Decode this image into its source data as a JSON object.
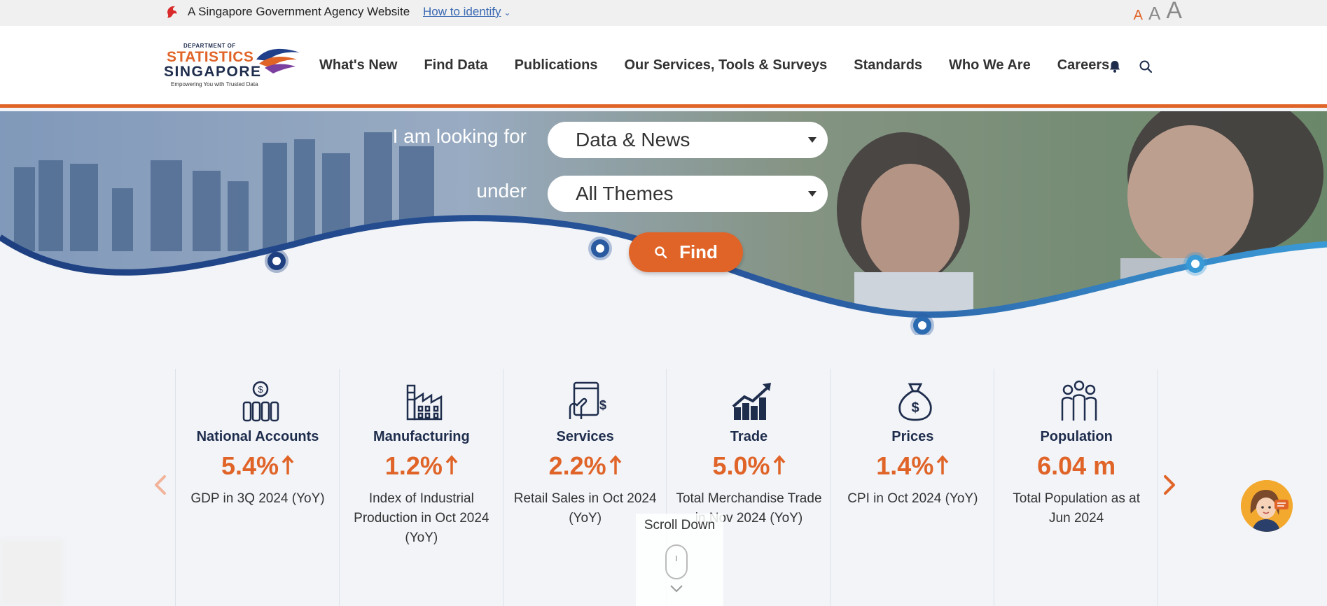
{
  "govbar": {
    "text": "A Singapore Government Agency Website",
    "how_to_identify": "How to identify",
    "font_sizes": [
      "A",
      "A",
      "A"
    ]
  },
  "logo": {
    "dept": "DEPARTMENT OF",
    "line1": "STATISTICS",
    "line2": "SINGAPORE",
    "tagline": "Empowering You with Trusted Data"
  },
  "nav": {
    "items": [
      {
        "label": "What's New"
      },
      {
        "label": "Find Data"
      },
      {
        "label": "Publications"
      },
      {
        "label": "Our Services, Tools & Surveys"
      },
      {
        "label": "Standards"
      },
      {
        "label": "Who We Are"
      },
      {
        "label": "Careers"
      }
    ],
    "icons": [
      "bell-icon",
      "search-icon"
    ]
  },
  "hero": {
    "looking_for_label": "I am looking for",
    "looking_for_value": "Data & News",
    "under_label": "under",
    "under_value": "All Themes",
    "find_label": "Find"
  },
  "stats": [
    {
      "title": "National Accounts",
      "value": "5.4%",
      "trend": "up",
      "desc": "GDP in 3Q 2024 (YoY)",
      "icon": "money-bars-icon"
    },
    {
      "title": "Manufacturing",
      "value": "1.2%",
      "trend": "up",
      "desc": "Index of Industrial Production in Oct 2024 (YoY)",
      "icon": "factory-icon"
    },
    {
      "title": "Services",
      "value": "2.2%",
      "trend": "up",
      "desc": "Retail Sales in Oct 2024 (YoY)",
      "icon": "card-payment-icon"
    },
    {
      "title": "Trade",
      "value": "5.0%",
      "trend": "up",
      "desc": "Total Merchandise Trade in Nov 2024 (YoY)",
      "icon": "growth-chart-icon"
    },
    {
      "title": "Prices",
      "value": "1.4%",
      "trend": "up",
      "desc": "CPI in Oct 2024 (YoY)",
      "icon": "money-bag-icon"
    },
    {
      "title": "Population",
      "value": "6.04 m",
      "trend": "",
      "desc": "Total Population as at Jun 2024",
      "icon": "people-icon"
    }
  ],
  "scroll": {
    "label": "Scroll Down"
  },
  "colors": {
    "accent": "#e06428",
    "navy": "#1f2d4d",
    "wave_dark": "#1e3f80",
    "wave_light": "#3a8fd0"
  }
}
